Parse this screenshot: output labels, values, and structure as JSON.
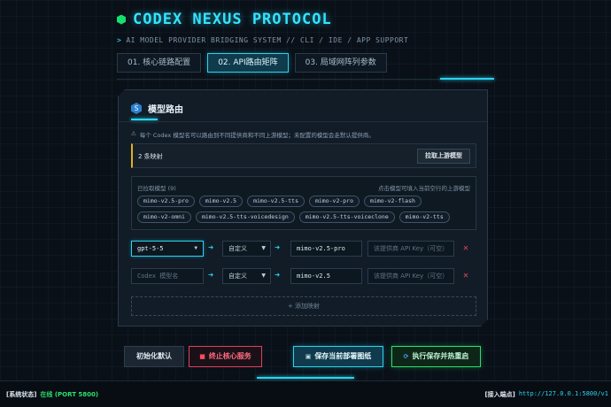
{
  "header": {
    "title": "CODEX NEXUS PROTOCOL",
    "subtitle_arrow": ">",
    "subtitle": "AI MODEL PROVIDER BRIDGING SYSTEM // CLI / IDE / APP SUPPORT",
    "accent_color": "#33e4ff"
  },
  "tabs": [
    {
      "label": "01. 核心链路配置",
      "active": false
    },
    {
      "label": "02. API路由矩阵",
      "active": true
    },
    {
      "label": "03. 局域网阵列参数",
      "active": false
    }
  ],
  "panel": {
    "icon": "shield-icon",
    "icon_glyph": "S",
    "title": "模型路由",
    "warning_icon": "⚠",
    "warning": "每个 Codex 模型名可以路由到不同提供商和不同上游模型；未配置的模型会走默认提供商。",
    "mapping_count": "2 条映射",
    "pull_button": "拉取上游模型",
    "models_label": "已拉取模型 (9)",
    "models_hint": "点击模型可填入当前空行的上游模型",
    "models": [
      "mimo-v2.5-pro",
      "mimo-v2.5",
      "mimo-v2.5-tts",
      "mimo-v2-pro",
      "mimo-v2-flash",
      "mimo-v2-omni",
      "mimo-v2.5-tts-voicedesign",
      "mimo-v2.5-tts-voiceclone",
      "mimo-v2-tts"
    ],
    "rows": [
      {
        "source": "gpt-5-5",
        "source_placeholder": "",
        "mode": "自定义",
        "target": "mimo-v2.5-pro",
        "key_placeholder": "该提供商 API Key（可空）"
      },
      {
        "source": "",
        "source_placeholder": "Codex 模型名",
        "mode": "自定义",
        "target": "mimo-v2.5",
        "key_placeholder": "该提供商 API Key（可空）"
      }
    ],
    "arrow_glyph": "➜",
    "caret_glyph": "▼",
    "delete_glyph": "✕",
    "add_mapping": "+ 添加映射"
  },
  "actions": {
    "init": "初始化默认",
    "stop_icon": "■",
    "stop": "终止核心服务",
    "save_icon": "▣",
    "save": "保存当前部署图纸",
    "run_icon": "⟳",
    "run": "执行保存并热重启"
  },
  "status": {
    "state_label": "[系统状态]",
    "state_value": "在线 (PORT 5800)",
    "endpoint_label": "[接入端点]",
    "endpoint_value": "http://127.0.0.1:5800/v1",
    "online_color": "#2be06c"
  }
}
